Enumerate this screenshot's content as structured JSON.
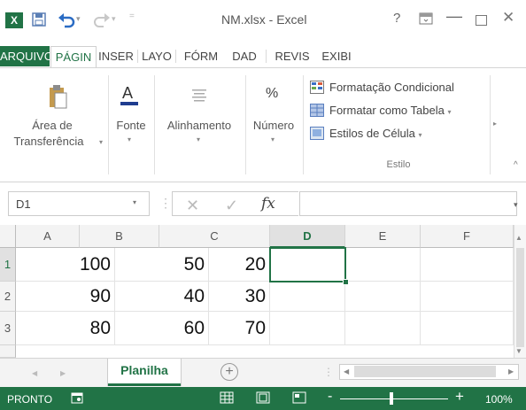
{
  "title_bar": {
    "app_logo": "X",
    "window_title": "NM.xlsx - Excel",
    "help": "?",
    "minimize": "—",
    "close": "✕"
  },
  "tabs": [
    {
      "label": "ARQUIVO",
      "active": false,
      "file": true
    },
    {
      "label": "PÁGIN",
      "active": true
    },
    {
      "label": "INSER",
      "active": false
    },
    {
      "label": "LAYO",
      "active": false
    },
    {
      "label": "FÓRM",
      "active": false
    },
    {
      "label": "DAD",
      "active": false
    },
    {
      "label": "REVIS",
      "active": false
    },
    {
      "label": "EXIBI",
      "active": false
    }
  ],
  "ribbon": {
    "clipboard_label_1": "Área de",
    "clipboard_label_2": "Transferência",
    "font_label": "Fonte",
    "alignment_label": "Alinhamento",
    "number_label": "Número",
    "number_symbol": "%",
    "styles": [
      "Formatação Condicional",
      "Formatar como Tabela",
      "Estilos de Célula"
    ],
    "styles_group_label": "Estilo"
  },
  "formula_bar": {
    "name_box": "D1",
    "fx": "fx",
    "formula": ""
  },
  "grid": {
    "columns": [
      "A",
      "B",
      "C",
      "D",
      "E",
      "F"
    ],
    "rows": [
      "1",
      "2",
      "3"
    ],
    "selected_cell": "D1",
    "cells": [
      [
        "100",
        "50",
        "20",
        "",
        "",
        ""
      ],
      [
        "90",
        "40",
        "30",
        "",
        "",
        ""
      ],
      [
        "80",
        "60",
        "70",
        "",
        "",
        ""
      ]
    ]
  },
  "sheet_bar": {
    "sheet_name": "Planilha",
    "add_sheet": "+"
  },
  "status_bar": {
    "status": "PRONTO",
    "zoom_minus": "-",
    "zoom_plus": "+",
    "zoom": "100%"
  },
  "colors": {
    "accent": "#217346"
  }
}
